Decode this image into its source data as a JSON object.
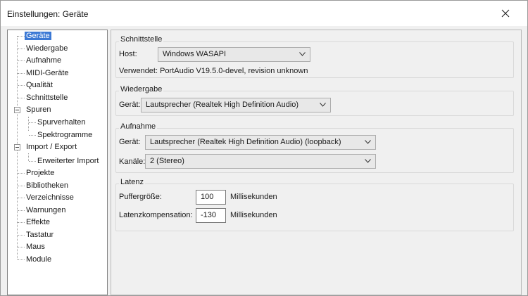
{
  "window": {
    "title": "Einstellungen: Geräte"
  },
  "tree": {
    "items": [
      {
        "label": "Geräte",
        "selected": true
      },
      {
        "label": "Wiedergabe"
      },
      {
        "label": "Aufnahme"
      },
      {
        "label": "MIDI-Geräte"
      },
      {
        "label": "Qualität"
      },
      {
        "label": "Schnittstelle"
      },
      {
        "label": "Spuren"
      },
      {
        "label": "Spurverhalten"
      },
      {
        "label": "Spektrogramme"
      },
      {
        "label": "Import / Export"
      },
      {
        "label": "Erweiterter Import"
      },
      {
        "label": "Projekte"
      },
      {
        "label": "Bibliotheken"
      },
      {
        "label": "Verzeichnisse"
      },
      {
        "label": "Warnungen"
      },
      {
        "label": "Effekte"
      },
      {
        "label": "Tastatur"
      },
      {
        "label": "Maus"
      },
      {
        "label": "Module"
      }
    ]
  },
  "schnittstelle": {
    "title": "Schnittstelle",
    "host_label": "Host:",
    "host_value": "Windows WASAPI",
    "uses_text": "Verwendet: PortAudio V19.5.0-devel, revision unknown"
  },
  "wiedergabe": {
    "title": "Wiedergabe",
    "device_label": "Gerät:",
    "device_value": "Lautsprecher (Realtek High Definition Audio)"
  },
  "aufnahme": {
    "title": "Aufnahme",
    "device_label": "Gerät:",
    "device_value": "Lautsprecher (Realtek High Definition Audio) (loopback)",
    "channels_label": "Kanäle:",
    "channels_value": "2 (Stereo)"
  },
  "latenz": {
    "title": "Latenz",
    "buffer_label": "Puffergröße:",
    "buffer_value": "100",
    "buffer_unit": "Millisekunden",
    "comp_label": "Latenzkompensation:",
    "comp_value": "-130",
    "comp_unit": "Millisekunden"
  },
  "icons": {
    "close": "close-icon",
    "dropdown": "chevron-down-icon",
    "expander": "minus-expander-icon"
  },
  "colors": {
    "selection": "#3b78d4",
    "window_bg": "#f0f0f0"
  }
}
